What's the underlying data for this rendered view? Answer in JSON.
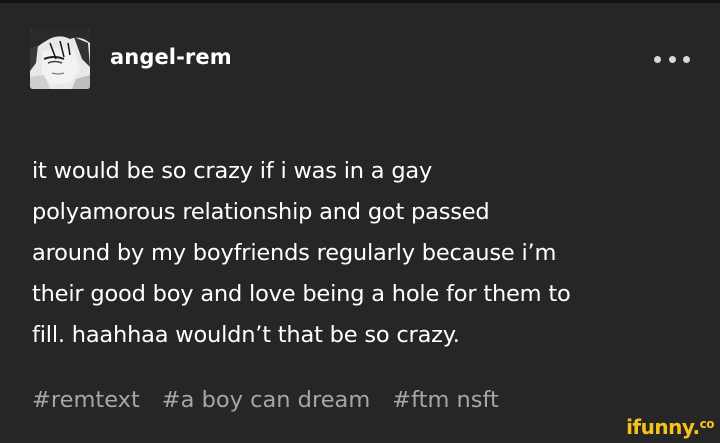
{
  "post": {
    "username": "angel-rem",
    "more_label": "More options",
    "body_lines": [
      "it would be so crazy if i was in a gay",
      "polyamorous relationship and got passed",
      "around by my boyfriends regularly because i’m",
      "their good boy and love being a hole for them to",
      "fill. haahhaa wouldn’t that be so crazy."
    ],
    "tags": [
      "#remtext",
      "#a boy can dream",
      "#ftm nsft"
    ]
  },
  "watermark": {
    "text": "ifunny.",
    "suffix": "co"
  },
  "colors": {
    "background": "#262626",
    "text": "#ffffff",
    "tags": "#a6a6a6",
    "watermark": "#f6c21a"
  },
  "icons": {
    "avatar": "anime-character-avatar",
    "more": "ellipsis-icon"
  }
}
